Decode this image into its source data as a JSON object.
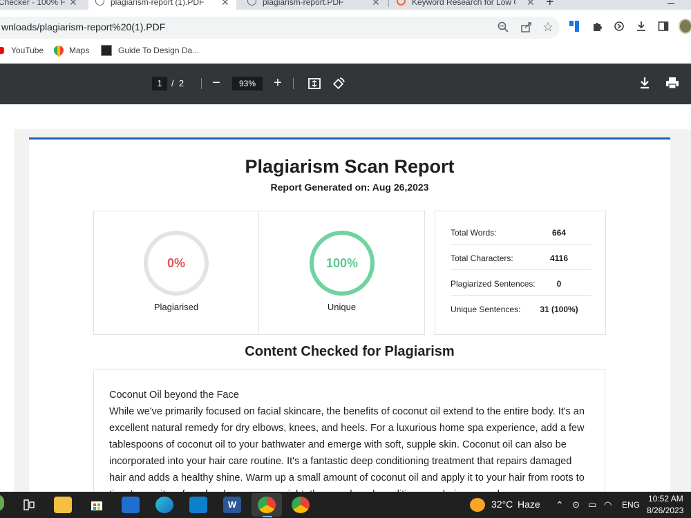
{
  "tabs": [
    {
      "title": "Checker - 100% F",
      "active": false
    },
    {
      "title": "plagiarism-report (1).PDF",
      "active": true
    },
    {
      "title": "plagiarism-report.PDF",
      "active": false
    },
    {
      "title": "Keyword Research for Low C",
      "active": false
    }
  ],
  "tab_close": "✕",
  "new_tab": "+",
  "address": {
    "url": "wnloads/plagiarism-report%20(1).PDF"
  },
  "bookmarks": [
    {
      "label": "YouTube",
      "icon": "youtube-icon"
    },
    {
      "label": "Maps",
      "icon": "maps-icon"
    },
    {
      "label": "Guide To Design Da...",
      "icon": "guide-icon"
    }
  ],
  "pdf_toolbar": {
    "current_page": "1",
    "separator": "/",
    "total_pages": "2",
    "zoom": "93%",
    "minus": "−",
    "plus": "+"
  },
  "report": {
    "title": "Plagiarism Scan Report",
    "subtitle": "Report Generated on: Aug 26,2023",
    "plagiarised": {
      "value": "0%",
      "label": "Plagiarised",
      "color": "#e05555",
      "ring_color": "#e3e3e3"
    },
    "unique": {
      "value": "100%",
      "label": "Unique",
      "color": "#5cc992",
      "ring_color": "#6fd3a0"
    },
    "stats": [
      {
        "key": "Total Words:",
        "value": "664"
      },
      {
        "key": "Total Characters:",
        "value": "4116"
      },
      {
        "key": "Plagiarized Sentences:",
        "value": "0"
      },
      {
        "key": "Unique Sentences:",
        "value": "31 (100%)"
      }
    ],
    "content_heading": "Content Checked for Plagiarism",
    "content_title": "Coconut Oil beyond the Face",
    "content_body": "While we've primarily focused on facial skincare, the benefits of coconut oil extend to the entire body. It's an excellent natural remedy for dry elbows, knees, and heels. For a luxurious home spa experience, add a few tablespoons of coconut oil to your bathwater and emerge with soft, supple skin. Coconut oil can also be incorporated into your hair care routine. It's a fantastic deep conditioning treatment that repairs damaged hair and adds a healthy shine. Warm up a small amount of coconut oil and apply it to your hair from roots to tips. Leave it on for a few hours or overnight, then wash and condition your hair as usual."
  },
  "taskbar": {
    "weather_temp": "32°C",
    "weather_desc": "Haze",
    "language": "ENG",
    "time": "10:52 AM",
    "date": "8/26/2023"
  }
}
